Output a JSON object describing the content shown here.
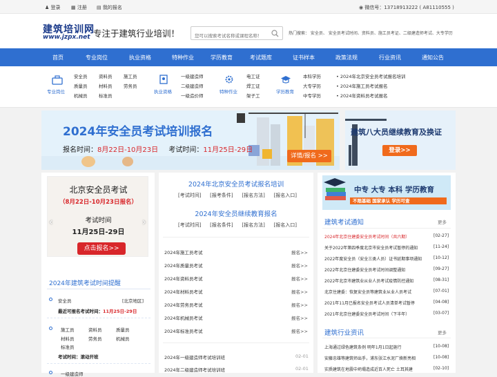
{
  "topbar": {
    "login": "登录",
    "register": "注册",
    "signup": "我的报名",
    "wechat": "微信号：13718913222 ( A81110555 )"
  },
  "header": {
    "logo_cn": "建筑培训网",
    "logo_en": "www.jzpx.net",
    "slogan": "专注于建筑行业培训！",
    "search_placeholder": "您可以搜索考试名称或课程名称！",
    "hot_search": "热门搜索：  安全员、  安全员考试时间、资料员、施工员考证、二级建造师考试、大专学历"
  },
  "nav": [
    "首页",
    "专业岗位",
    "执业资格",
    "特种作业",
    "学历教育",
    "考试题库",
    "证书样本",
    "政策法规",
    "行业资讯",
    "通知公告"
  ],
  "cats": {
    "g1": {
      "label": "专业岗位",
      "items": [
        "安全员",
        "资料员",
        "施工员",
        "质量员",
        "材料员",
        "劳务员",
        "机械员",
        "标准员"
      ]
    },
    "g2": {
      "label": "执业资格",
      "items": [
        "一级建造师",
        "二级建造师",
        "一级造价师"
      ]
    },
    "g3": {
      "label": "特种作业",
      "items": [
        "电工证",
        "焊工证",
        "架子工"
      ]
    },
    "g4": {
      "label": "学历教育",
      "items": [
        "本科学历",
        "大专学历",
        "中专学历"
      ]
    },
    "news": [
      "2024年北京安全员考试报名培训",
      "2024年施工员考试报名",
      "2024年资料员考试报名"
    ]
  },
  "banner": {
    "title": "2024年安全员考试培训报名",
    "date_label": "报名时间：",
    "date": "8月22日-10月23日",
    "exam_label": "考试时间：",
    "exam": "11月25日-29日",
    "button": "详情/报名 >>"
  },
  "banner2": {
    "title": "建筑八大员继续教育及换证",
    "button": "登录>>"
  },
  "left": {
    "title": "北京安全员考试",
    "range": "（8月22日-10月23日报名）",
    "exam_label": "考试时间",
    "exam_date": "11月25日-29日",
    "btn": "点击报名>>",
    "remind_title": "2024年建筑考试时间提醒",
    "r1_name": "安全员",
    "r1_region": "[北京地区]",
    "r1_time_label": "最近可报名考试时间：",
    "r1_time": "11月25日-29日",
    "r2_items": [
      "施工员",
      "资料员",
      "质量员",
      "材料员",
      "劳务员",
      "机械员",
      "标准员"
    ],
    "r2_time_label": "考试时间：",
    "r2_time": "滚动开班",
    "r3_items": [
      "一级建造师"
    ]
  },
  "center": {
    "h1": "2024年北京安全员考试报名培训",
    "links1": [
      "[考试时间]",
      "[报考条件]",
      "[报名方法]",
      "[报名入口]"
    ],
    "h2": "2024年安全员继续教育报名",
    "links2": [
      "[考试时间]",
      "[报名条件]",
      "[报名方法]",
      "[报名入口]"
    ],
    "list": [
      {
        "name": "2024年施工员考试",
        "action": "报名>>"
      },
      {
        "name": "2024年质量员考试",
        "action": "报名>>"
      },
      {
        "name": "2024年资料员考试",
        "action": "报名>>"
      },
      {
        "name": "2024年材料员考试",
        "action": "报名>>"
      },
      {
        "name": "2024年劳务员考试",
        "action": "报名>>"
      },
      {
        "name": "2024年机械员考试",
        "action": "报名>>"
      },
      {
        "name": "2024年标准员考试",
        "action": "报名>>"
      }
    ],
    "list2": [
      {
        "name": "2024年一级建造师考试培训班",
        "date": "02-01"
      },
      {
        "name": "2024年二级建造师考试培训班",
        "date": "02-01"
      }
    ]
  },
  "right": {
    "banner_text": "中专  大专  本科  学历教育",
    "banner_sub": "不限基础    国家承认    学历可查",
    "notice_title": "建筑考试通知",
    "more": "更多",
    "notices": [
      {
        "t": "2024年北京住建委安全员考试时间（共六期）",
        "d": "[02-27]"
      },
      {
        "t": "关于2022年第四季度北京市安全员考试暂停的通知",
        "d": "[11-24]"
      },
      {
        "t": "2022年度安全员（安全三类人员）证书延期事项通知",
        "d": "[10-12]"
      },
      {
        "t": "2022年北京住建委安全员考试时间调整通知",
        "d": "[09-27]"
      },
      {
        "t": "2022年北京市建筑业从业人员考试疫情防控通知",
        "d": "[08-31]"
      },
      {
        "t": "北京住建委：恢复安全员等建筑业从业人员考试",
        "d": "[07-01]"
      },
      {
        "t": "2021年11月已报名安全员考试人员清单考试暂停",
        "d": "[04-08]"
      },
      {
        "t": "2021年北京住建委安全员考试时间（下半年）",
        "d": "[03-07]"
      }
    ],
    "industry_title": "建筑行业资讯",
    "industry": [
      {
        "t": "上海通过绿色建筑条例 明年1月1日起施行",
        "d": "[10-08]"
      },
      {
        "t": "安藤忠雄等建筑师出手，浦东张江水泥厂焕新亮相",
        "d": "[10-08]"
      },
      {
        "t": "实质建筑在地震中坍塌造成近百人死亡 土耳其建",
        "d": "[02-10]"
      }
    ]
  },
  "colors": {
    "blue": "#2f6fd0",
    "red": "#d8262a",
    "orange": "#f06a1c"
  }
}
